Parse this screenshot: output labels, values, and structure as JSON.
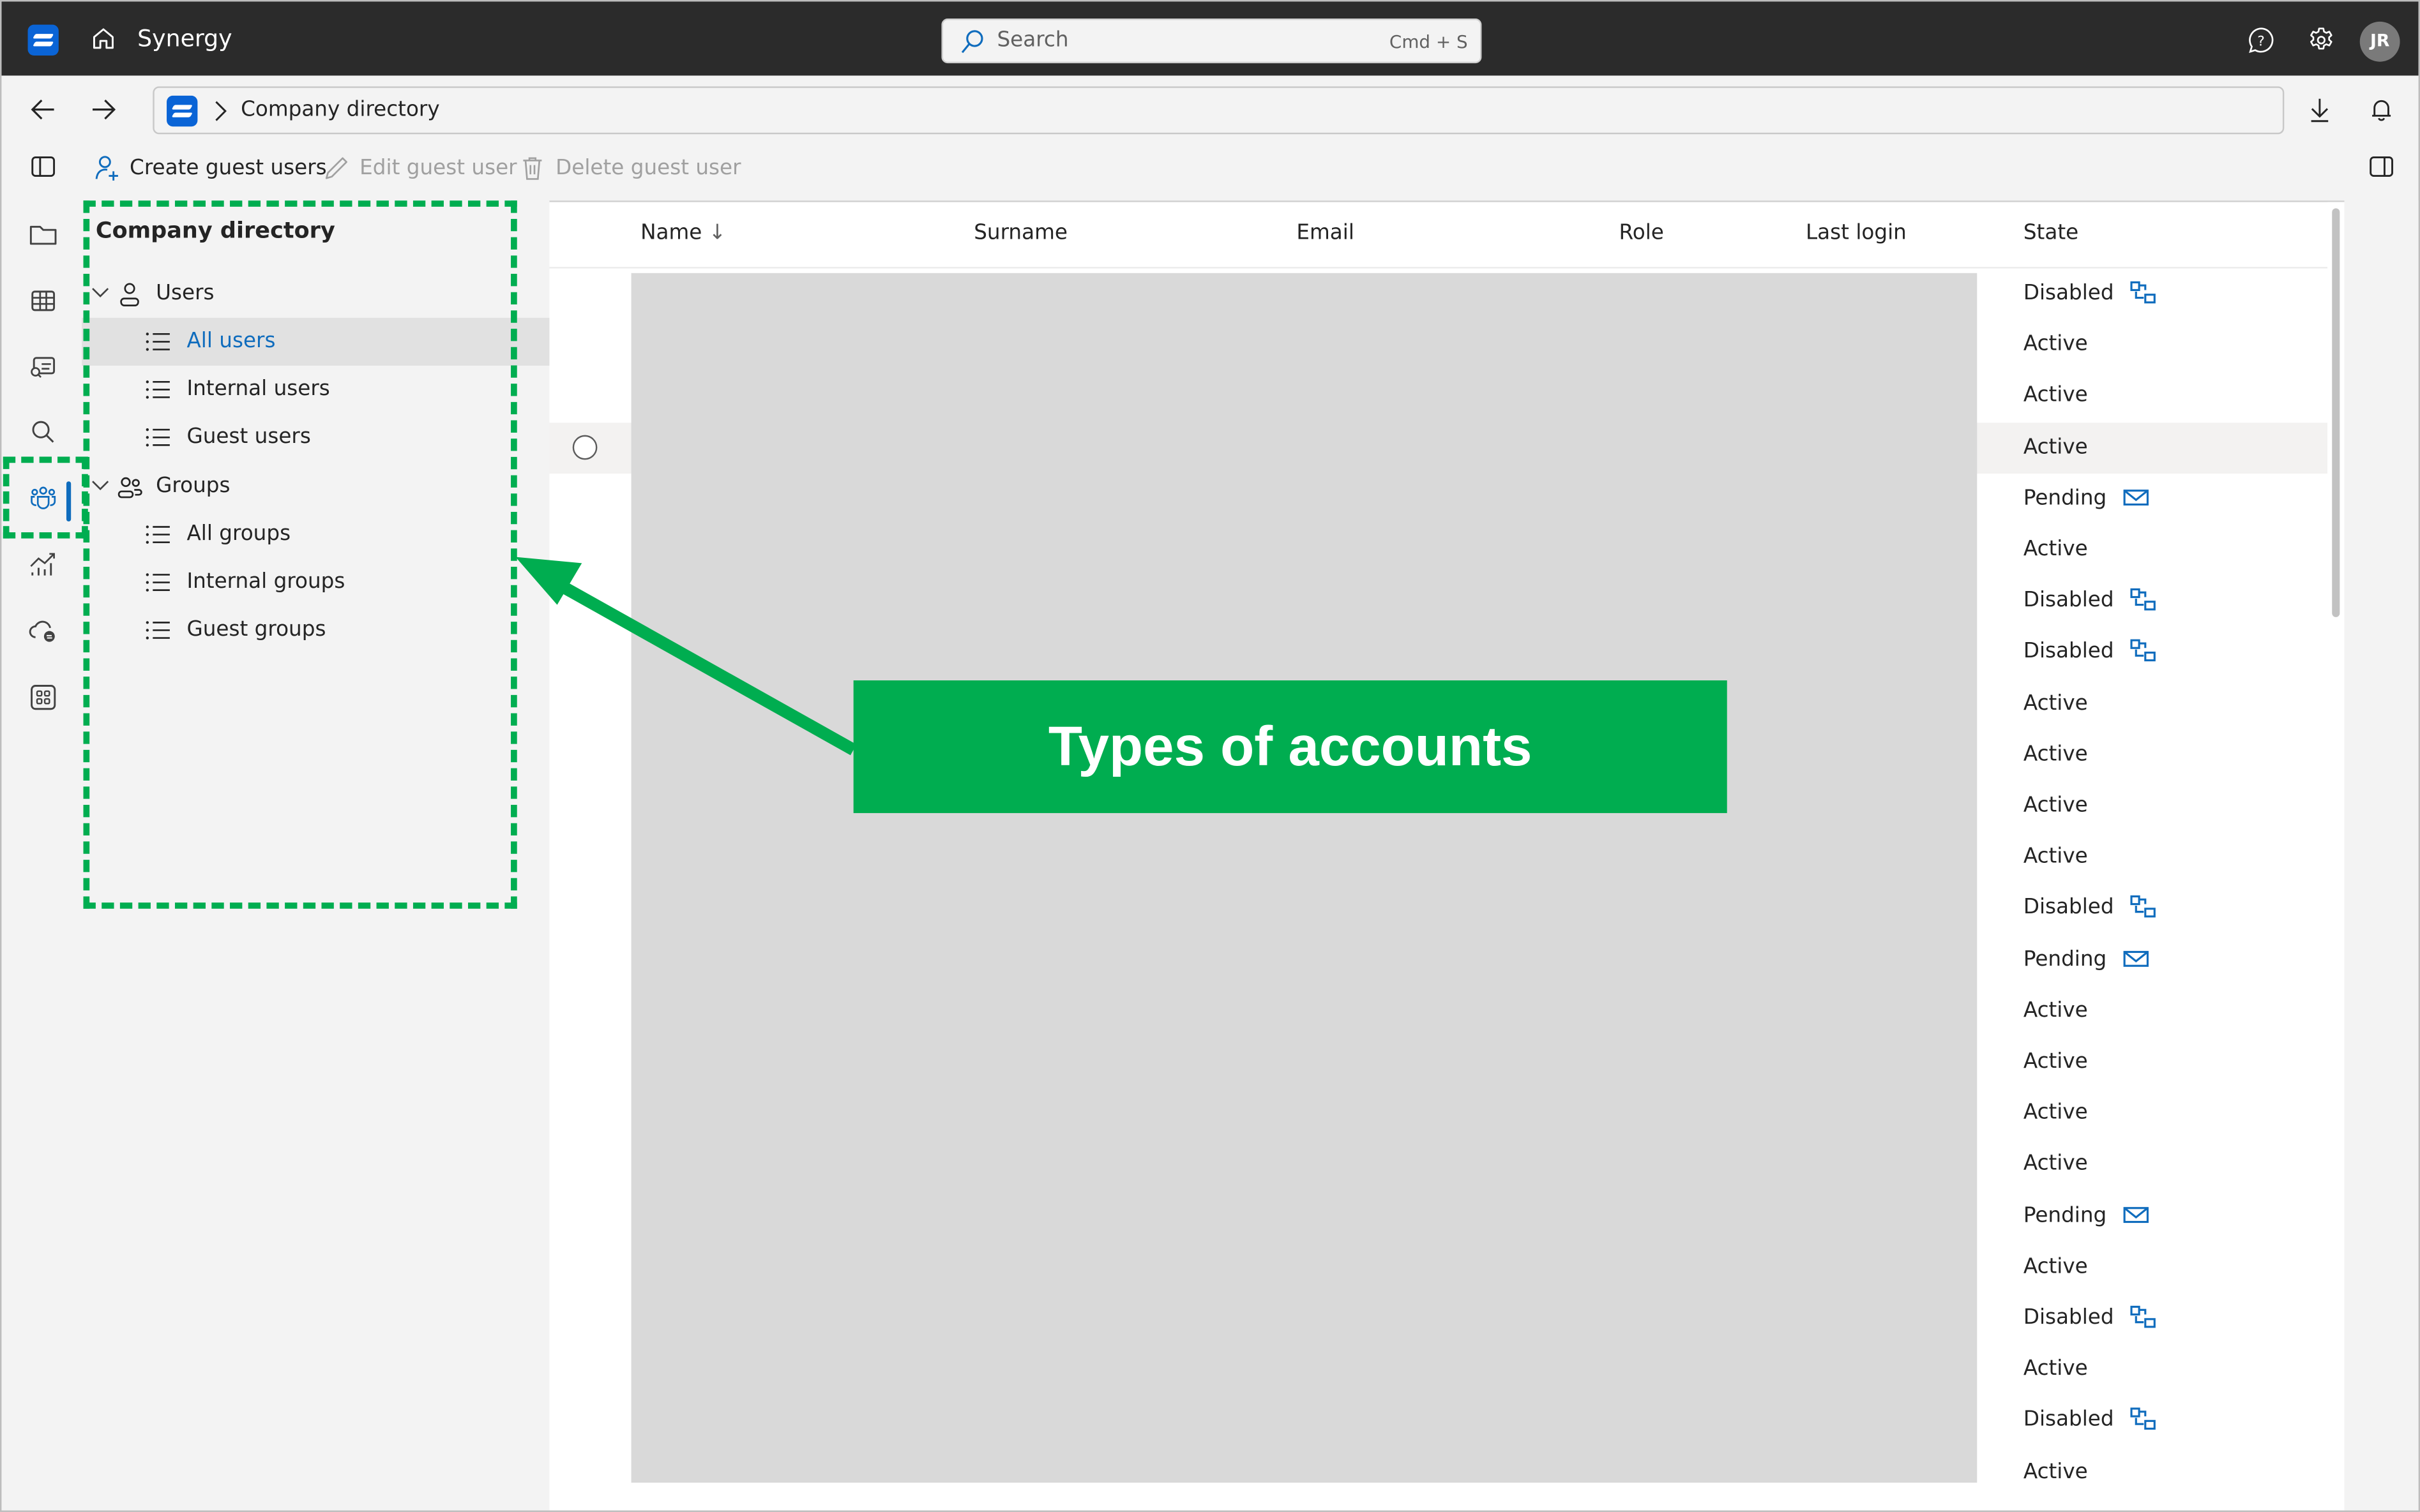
{
  "titlebar": {
    "app_name": "Synergy",
    "search_placeholder": "Search",
    "search_shortcut": "Cmd + S",
    "avatar_initials": "JR",
    "icons": [
      "app-logo",
      "home-icon",
      "search-icon",
      "help-icon",
      "settings-icon",
      "avatar"
    ]
  },
  "addressbar": {
    "breadcrumb": [
      "Synergy",
      "Company directory"
    ],
    "current": "Company directory",
    "icons": [
      "back-arrow-icon",
      "forward-arrow-icon",
      "download-icon",
      "bell-icon"
    ]
  },
  "toolbar": {
    "create_label": "Create guest users",
    "edit_label": "Edit guest user",
    "delete_label": "Delete guest user",
    "edit_enabled": false,
    "delete_enabled": false
  },
  "rail": {
    "items": [
      "folder",
      "table",
      "search-document",
      "search",
      "people",
      "analytics",
      "cloud-sync",
      "apps"
    ],
    "active": "people"
  },
  "tree": {
    "title": "Company directory",
    "groups": [
      {
        "label": "Users",
        "items": [
          "All users",
          "Internal users",
          "Guest users"
        ]
      },
      {
        "label": "Groups",
        "items": [
          "All groups",
          "Internal groups",
          "Guest groups"
        ]
      }
    ],
    "selected": "All users"
  },
  "table": {
    "columns": [
      "Name",
      "Surname",
      "Email",
      "Role",
      "Last login",
      "State"
    ],
    "sort_column": "Name",
    "sort_direction": "descending",
    "sort_glyph": "↓",
    "rows": [
      {
        "state": "Disabled",
        "icon": "sync-icon"
      },
      {
        "state": "Active",
        "icon": ""
      },
      {
        "state": "Active",
        "icon": ""
      },
      {
        "state": "Active",
        "icon": ""
      },
      {
        "state": "Pending",
        "icon": "mail-icon"
      },
      {
        "state": "Active",
        "icon": ""
      },
      {
        "state": "Disabled",
        "icon": "sync-icon"
      },
      {
        "state": "Disabled",
        "icon": "sync-icon"
      },
      {
        "state": "Active",
        "icon": ""
      },
      {
        "state": "Active",
        "icon": ""
      },
      {
        "state": "Active",
        "icon": ""
      },
      {
        "state": "Active",
        "icon": ""
      },
      {
        "state": "Disabled",
        "icon": "sync-icon"
      },
      {
        "state": "Pending",
        "icon": "mail-icon"
      },
      {
        "state": "Active",
        "icon": ""
      },
      {
        "state": "Active",
        "icon": ""
      },
      {
        "state": "Active",
        "icon": ""
      },
      {
        "state": "Active",
        "icon": ""
      },
      {
        "state": "Pending",
        "icon": "mail-icon"
      },
      {
        "state": "Active",
        "icon": ""
      },
      {
        "state": "Disabled",
        "icon": "sync-icon"
      },
      {
        "state": "Active",
        "icon": ""
      },
      {
        "state": "Disabled",
        "icon": "sync-icon"
      },
      {
        "state": "Active",
        "icon": ""
      }
    ],
    "hovered_row": 3,
    "redacted": true
  },
  "annotation": {
    "label": "Types of accounts",
    "color": "#00ad50"
  },
  "colors": {
    "accent": "#0f6cbd",
    "titlebar": "#2b2b2b",
    "annotation": "#00ad50",
    "redaction": "#d9d9d9"
  }
}
